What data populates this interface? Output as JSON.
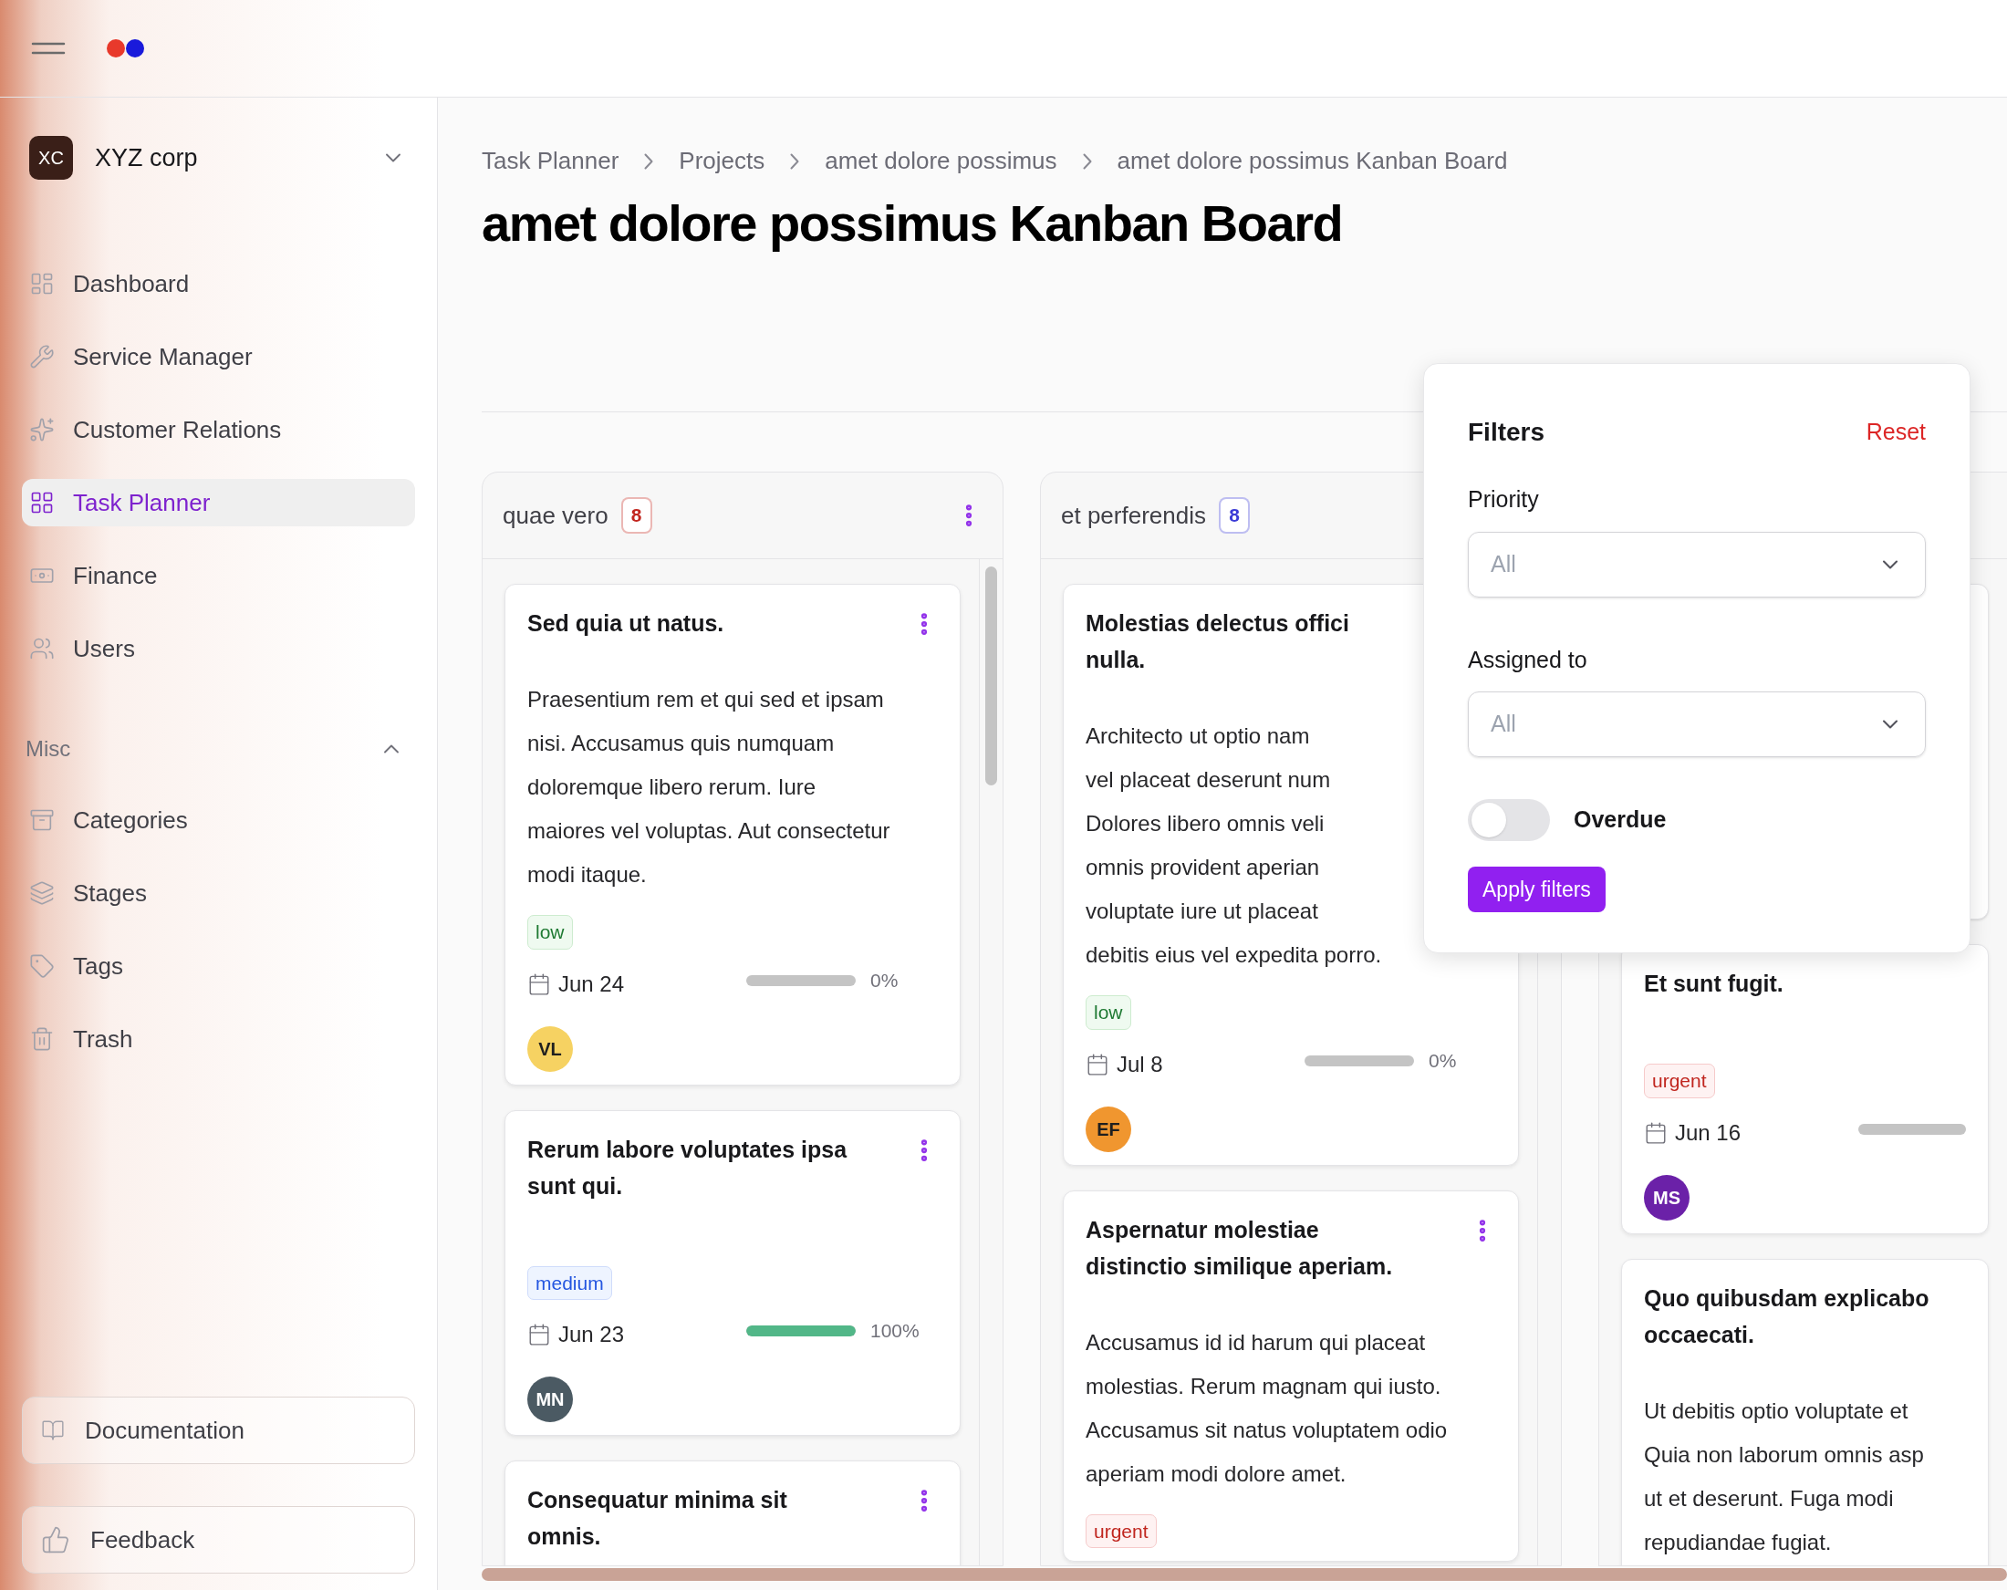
{
  "org": {
    "initials": "XC",
    "name": "XYZ corp"
  },
  "nav": [
    {
      "label": "Dashboard",
      "selected": false
    },
    {
      "label": "Service Manager",
      "selected": false
    },
    {
      "label": "Customer Relations",
      "selected": false
    },
    {
      "label": "Task Planner",
      "selected": true
    },
    {
      "label": "Finance",
      "selected": false
    },
    {
      "label": "Users",
      "selected": false
    }
  ],
  "misc": {
    "label": "Misc",
    "expanded": true,
    "items": [
      {
        "label": "Categories",
        "selected": false
      },
      {
        "label": "Stages",
        "selected": false
      },
      {
        "label": "Tags",
        "selected": false
      },
      {
        "label": "Trash",
        "selected": false
      }
    ]
  },
  "footer_buttons": [
    {
      "label": "Documentation"
    },
    {
      "label": "Feedback"
    }
  ],
  "breadcrumb": [
    "Task Planner",
    "Projects",
    "amet dolore possimus",
    "amet dolore possimus Kanban Board"
  ],
  "title": "amet dolore possimus Kanban Board",
  "columns": [
    {
      "name": "quae vero",
      "count": "8",
      "color": "#c2261f",
      "menu": true,
      "cards": [
        {
          "kind": "task",
          "menu": true,
          "title_lines": [
            "Sed quia ut natus."
          ],
          "description_lines": [
            "Praesentium rem et qui sed et ipsam",
            "nisi. Accusamus quis numquam",
            "doloremque libero rerum. Iure",
            "maiores vel voluptas. Aut consectetur",
            "modi itaque."
          ],
          "priority": {
            "label": "low",
            "kind": "low"
          },
          "due": "Jun 24",
          "level": 0,
          "percent": "0%",
          "assignee": {
            "initials": "VL",
            "color": "#f6d262"
          }
        },
        {
          "kind": "task",
          "menu": true,
          "title_lines": [
            "Rerum labore voluptates ipsa",
            "sunt qui."
          ],
          "priority": {
            "label": "medium",
            "kind": "medium"
          },
          "due": "Jun 23",
          "level": 1,
          "percent": "100%",
          "assignee": {
            "initials": "MN",
            "color": "#4b5a63"
          }
        },
        {
          "kind": "task",
          "menu": true,
          "title_lines": [
            "Consequatur minima sit",
            "omnis."
          ]
        }
      ]
    },
    {
      "name": "et perferendis",
      "count": "8",
      "color": "#3b3bd6",
      "menu": false,
      "cards": [
        {
          "kind": "task",
          "menu": false,
          "title_lines": [
            "Molestias delectus offici",
            "nulla."
          ],
          "description_lines": [
            "Architecto ut optio nam",
            "vel placeat deserunt num",
            "Dolores libero omnis veli",
            "omnis provident aperian",
            "voluptate iure ut placeat",
            "debitis eius vel expedita porro."
          ],
          "priority": {
            "label": "low",
            "kind": "low"
          },
          "due": "Jul 8",
          "level": 0,
          "percent": "0%",
          "assignee": {
            "initials": "EF",
            "color": "#f0962f"
          }
        },
        {
          "kind": "task",
          "menu": true,
          "title_lines": [
            "Aspernatur molestiae",
            "distinctio similique aperiam."
          ],
          "description_lines": [
            "Accusamus id id harum qui placeat",
            "molestias. Rerum magnam qui iusto.",
            "Accusamus sit natus voluptatem odio",
            "aperiam modi dolore amet."
          ],
          "priority": {
            "label": "urgent",
            "kind": "urgent"
          }
        }
      ]
    },
    {
      "menu": false,
      "cards": [
        {
          "kind": "covered"
        },
        {
          "kind": "task",
          "menu": false,
          "title_lines": [
            "Et sunt fugit."
          ],
          "priority": {
            "label": "urgent",
            "kind": "urgent"
          },
          "due": "Jun 16",
          "level": 0,
          "assignee": {
            "initials": "MS",
            "color": "#6b21a8"
          }
        },
        {
          "kind": "task",
          "menu": false,
          "title_lines": [
            "Quo quibusdam explicabo",
            "occaecati."
          ],
          "description_lines": [
            "Ut debitis optio voluptate et",
            "Quia non laborum omnis asp",
            "ut et deserunt. Fuga modi",
            "repudiandae fugiat."
          ]
        }
      ]
    }
  ],
  "filters": {
    "title": "Filters",
    "reset": "Reset",
    "fields": [
      {
        "label": "Priority",
        "placeholder": "All"
      },
      {
        "label": "Assigned to",
        "placeholder": "All"
      }
    ],
    "overdue": {
      "label": "Overdue",
      "on": false
    },
    "apply": "Apply filters"
  }
}
